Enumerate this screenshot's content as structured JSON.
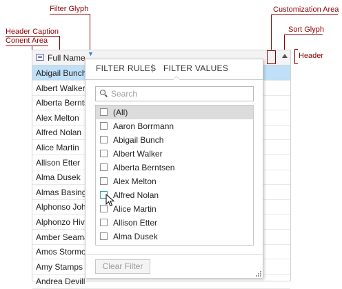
{
  "annotations": {
    "filter_glyph": "Filter Glyph",
    "customization_area": "Customization Area",
    "header_caption": "Header Caption",
    "content_area": "Conent Area",
    "sort_glyph": "Sort Glyph",
    "header": "Header"
  },
  "grid": {
    "column_caption": "Full Name",
    "rows": [
      "Abigail Bunch",
      "Albert Walker",
      "Alberta Bernts",
      "Alex Melton",
      "Alfred Nolan",
      "Alice Martin",
      "Allison Etter",
      "Alma Dusek",
      "Almas Basing",
      "Alphonso Joh",
      "Alphonzo Hiv",
      "Amber Seama",
      "Amos Stormo",
      "Amy Stamps",
      "Andrea Devill"
    ],
    "selected_row": "Abigail Bunch"
  },
  "popup": {
    "tabs": [
      "FILTER RULES",
      "FILTER VALUES"
    ],
    "active_tab": "FILTER VALUES",
    "search_placeholder": "Search",
    "values": [
      "(All)",
      "Aaron Borrmann",
      "Abigail Bunch",
      "Albert Walker",
      "Alberta Berntsen",
      "Alex Melton",
      "Alfred Nolan",
      "Alice Martin",
      "Allison Etter",
      "Alma Dusek"
    ],
    "clear_filter_label": "Clear Filter"
  },
  "colors": {
    "annotation": "#8b0000",
    "selection": "#bfe0f7",
    "filter_glyph": "#2f7fd0"
  },
  "icons": {
    "column": "column-icon",
    "filter": "filter-glyph-icon",
    "sort": "sort-ascending-icon",
    "search": "search-icon",
    "resize": "resize-grip-icon",
    "cursor": "mouse-pointer-icon"
  }
}
